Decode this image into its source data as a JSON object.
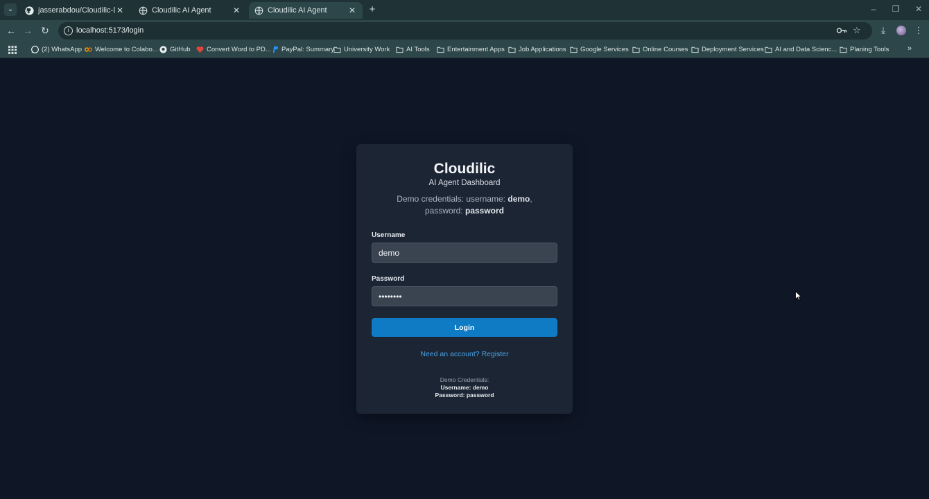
{
  "browser": {
    "tabs": [
      {
        "title": "jasserabdou/Cloudilic-Dragify-A",
        "icon": "github-icon"
      },
      {
        "title": "Cloudilic AI Agent",
        "icon": "globe-icon"
      },
      {
        "title": "Cloudilic AI Agent",
        "icon": "globe-icon",
        "active": true
      }
    ],
    "url": "localhost:5173/login",
    "bookmarks": [
      {
        "label": "(2) WhatsApp",
        "icon": "whatsapp-icon"
      },
      {
        "label": "Welcome to Colabo...",
        "icon": "colab-icon"
      },
      {
        "label": "GitHub",
        "icon": "github-icon"
      },
      {
        "label": "Convert Word to PD...",
        "icon": "heart-icon"
      },
      {
        "label": "PayPal: Summary",
        "icon": "paypal-icon"
      },
      {
        "label": "University Work",
        "icon": "folder-icon"
      },
      {
        "label": "AI Tools",
        "icon": "folder-icon"
      },
      {
        "label": "Entertainment Apps",
        "icon": "folder-icon"
      },
      {
        "label": "Job Applications",
        "icon": "folder-icon"
      },
      {
        "label": "Google Services",
        "icon": "folder-icon"
      },
      {
        "label": "Online Courses",
        "icon": "folder-icon"
      },
      {
        "label": "Deployment Services",
        "icon": "folder-icon"
      },
      {
        "label": "AI and Data Scienc...",
        "icon": "folder-icon"
      },
      {
        "label": "Planing Tools",
        "icon": "folder-icon"
      }
    ],
    "colors": {
      "chrome": "#2d4649",
      "page": "#0f1727"
    }
  },
  "login": {
    "brand": "Cloudilic",
    "subtitle": "AI Agent Dashboard",
    "demo_prefix": "Demo credentials: username: ",
    "demo_username": "demo",
    "demo_mid": ", password: ",
    "demo_password": "password",
    "username_label": "Username",
    "username_value": "demo",
    "password_label": "Password",
    "password_value": "password",
    "login_button": "Login",
    "register_link": "Need an account? Register",
    "footer_title": "Demo Credentials:",
    "footer_username": "Username: demo",
    "footer_password": "Password: password",
    "colors": {
      "card": "#1c2533",
      "button": "#0e7bc4",
      "link": "#4aa3e8"
    }
  }
}
